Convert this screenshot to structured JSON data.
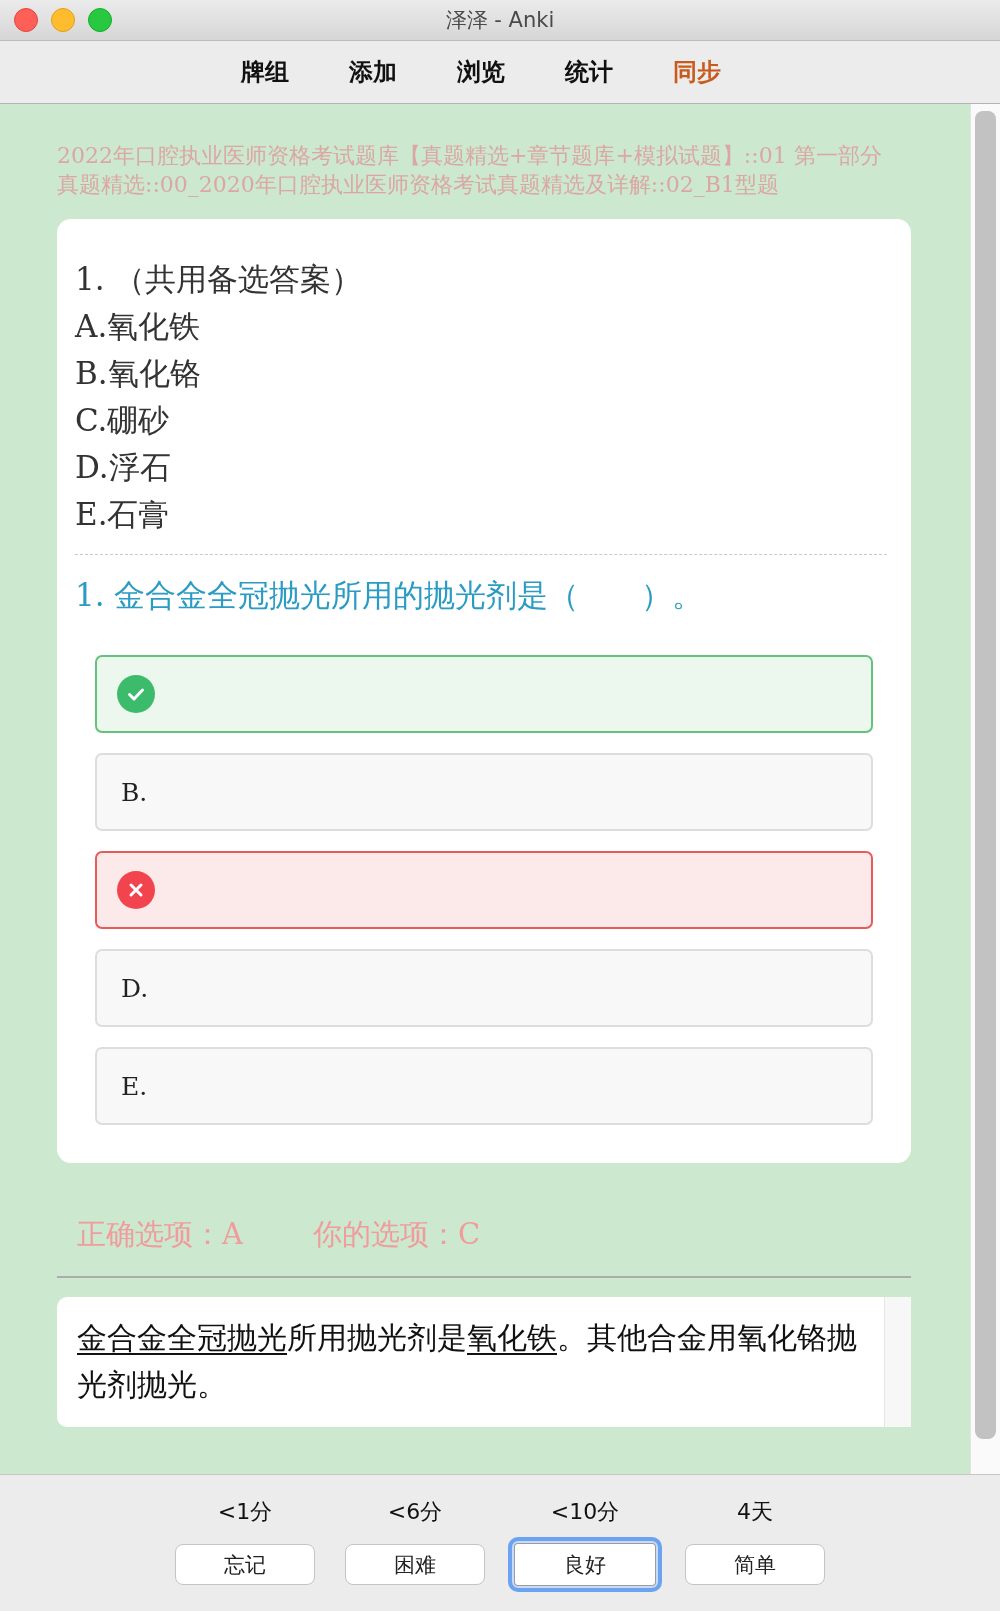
{
  "window": {
    "title": "泽泽 - Anki"
  },
  "toolbar": {
    "items": [
      {
        "label": "牌组",
        "highlighted": false
      },
      {
        "label": "添加",
        "highlighted": false
      },
      {
        "label": "浏览",
        "highlighted": false
      },
      {
        "label": "统计",
        "highlighted": false
      },
      {
        "label": "同步",
        "highlighted": true
      }
    ]
  },
  "deck_path": "2022年口腔执业医师资格考试题库【真题精选+章节题库+模拟试题】::01 第一部分真题精选::00_2020年口腔执业医师资格考试真题精选及详解::02_B1型题",
  "card": {
    "heading": "1. （共用备选答案）",
    "choices": [
      "A.氧化铁",
      "B.氧化铬",
      "C.硼砂",
      "D.浮石",
      "E.石膏"
    ],
    "question": "1. 金合金全冠抛光所用的抛光剂是（　　）。",
    "options": [
      {
        "kind": "correct"
      },
      {
        "kind": "plain",
        "label": "B."
      },
      {
        "kind": "wrong"
      },
      {
        "kind": "plain",
        "label": "D."
      },
      {
        "kind": "plain",
        "label": "E."
      }
    ]
  },
  "result": {
    "correct_answer": "正确选项：A",
    "your_answer": "你的选项：C"
  },
  "explanation": [
    {
      "text": "金合金全冠抛光",
      "underlined": true
    },
    {
      "text": "所用抛光剂是",
      "underlined": false
    },
    {
      "text": "氧化铁",
      "underlined": true
    },
    {
      "text": "。其他合金用氧化铬抛光剂抛光。",
      "underlined": false
    }
  ],
  "answer_buttons": [
    {
      "interval": "<1分",
      "label": "忘记",
      "focused": false
    },
    {
      "interval": "<6分",
      "label": "困难",
      "focused": false
    },
    {
      "interval": "<10分",
      "label": "良好",
      "focused": true
    },
    {
      "interval": "4天",
      "label": "简单",
      "focused": false
    }
  ]
}
